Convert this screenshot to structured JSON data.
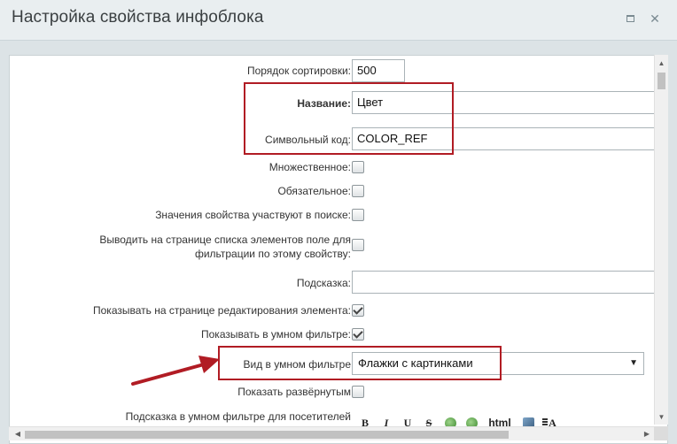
{
  "window": {
    "title": "Настройка свойства инфоблока",
    "close_glyph": "✕"
  },
  "form": {
    "sort": {
      "label": "Порядок сортировки:",
      "value": "500"
    },
    "name": {
      "label": "Название:",
      "value": "Цвет"
    },
    "code": {
      "label": "Символьный код:",
      "value": "COLOR_REF"
    },
    "multiple": {
      "label": "Множественное:",
      "checked": false
    },
    "required": {
      "label": "Обязательное:",
      "checked": false
    },
    "searchable": {
      "label": "Значения свойства участвуют в поиске:",
      "checked": false
    },
    "filter_list": {
      "label": "Выводить на странице списка элементов поле для фильтрации по этому свойству:",
      "checked": false
    },
    "hint": {
      "label": "Подсказка:",
      "value": ""
    },
    "show_edit": {
      "label": "Показывать на странице редактирования элемента:",
      "checked": true
    },
    "show_smart": {
      "label": "Показывать в умном фильтре:",
      "checked": true
    },
    "smart_view": {
      "label": "Вид в умном фильтре",
      "value": "Флажки с картинками"
    },
    "expanded": {
      "label": "Показать развёрнутым",
      "checked": false
    },
    "smart_hint": {
      "label": "Подсказка в умном фильтре для посетителей"
    }
  },
  "editor_toolbar": {
    "bold": "B",
    "italic": "I",
    "underline": "U",
    "strike": "S",
    "html": "html",
    "font": "A"
  },
  "colors": {
    "highlight": "#b11c24",
    "title_bar": "#e9eef0",
    "background": "#dce3e6"
  }
}
